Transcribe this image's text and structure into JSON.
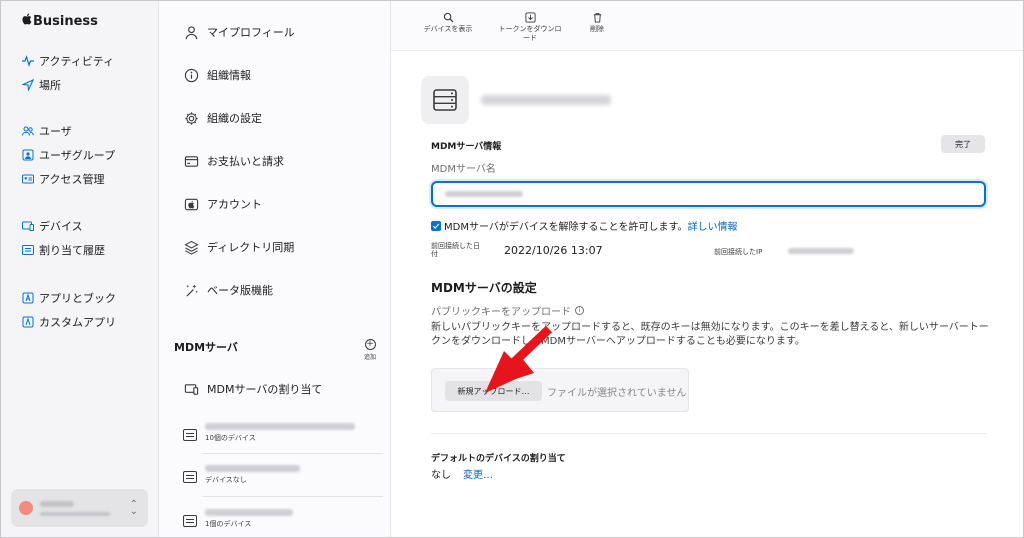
{
  "sidebar": {
    "brand": "Business",
    "groups": [
      [
        {
          "label": "アクティビティ",
          "icon": "activity-icon"
        },
        {
          "label": "場所",
          "icon": "location-icon"
        }
      ],
      [
        {
          "label": "ユーザ",
          "icon": "users-icon"
        },
        {
          "label": "ユーザグループ",
          "icon": "user-group-icon"
        },
        {
          "label": "アクセス管理",
          "icon": "access-card-icon"
        }
      ],
      [
        {
          "label": "デバイス",
          "icon": "devices-icon"
        },
        {
          "label": "割り当て履歴",
          "icon": "history-icon"
        }
      ],
      [
        {
          "label": "アプリとブック",
          "icon": "apps-icon"
        },
        {
          "label": "カスタムアプリ",
          "icon": "custom-app-icon"
        }
      ]
    ]
  },
  "settings": {
    "items": [
      {
        "label": "マイプロフィール",
        "icon": "person-icon"
      },
      {
        "label": "組織情報",
        "icon": "info-icon"
      },
      {
        "label": "組織の設定",
        "icon": "gear-icon"
      },
      {
        "label": "お支払いと請求",
        "icon": "card-icon"
      },
      {
        "label": "アカウント",
        "icon": "apple-icon"
      },
      {
        "label": "ディレクトリ同期",
        "icon": "sync-icon"
      },
      {
        "label": "ベータ版機能",
        "icon": "sparkle-icon"
      }
    ],
    "mdm_header": "MDMサーバ",
    "add_label": "追加",
    "assign_label": "MDMサーバの割り当て",
    "servers": [
      {
        "sub": "10個のデバイス"
      },
      {
        "sub": "デバイスなし"
      },
      {
        "sub": "1個のデバイス"
      }
    ]
  },
  "toolbar": {
    "show_devices": "デバイスを表示",
    "download_token_line1": "トークンをダウンロ",
    "download_token_line2": "ード",
    "delete": "削除"
  },
  "detail": {
    "section_title": "MDMサーバ情報",
    "done": "完了",
    "name_label": "MDMサーバ名",
    "release_text": "MDMサーバがデバイスを解除することを許可します。",
    "more_info": "詳しい情報",
    "last_connected_label_1": "前回接続した日",
    "last_connected_label_2": "付",
    "last_connected_value": "2022/10/26 13:07",
    "last_ip_label": "前回接続したIP",
    "settings_title": "MDMサーバの設定",
    "public_key_label": "パブリックキーをアップロード",
    "description": "新しいパブリックキーをアップロードすると、既存のキーは無効になります。このキーを差し替えると、新しいサーバートークンをダウンロードし、MDMサーバーへアップロードすることも必要になります。",
    "upload_button": "新規アップロード…",
    "no_file": "ファイルが選択されていません",
    "default_assign_label": "デフォルトのデバイスの割り当て",
    "default_value": "なし",
    "change": "変更…"
  },
  "colors": {
    "accent": "#0071e3",
    "arrow": "#e8141b"
  }
}
